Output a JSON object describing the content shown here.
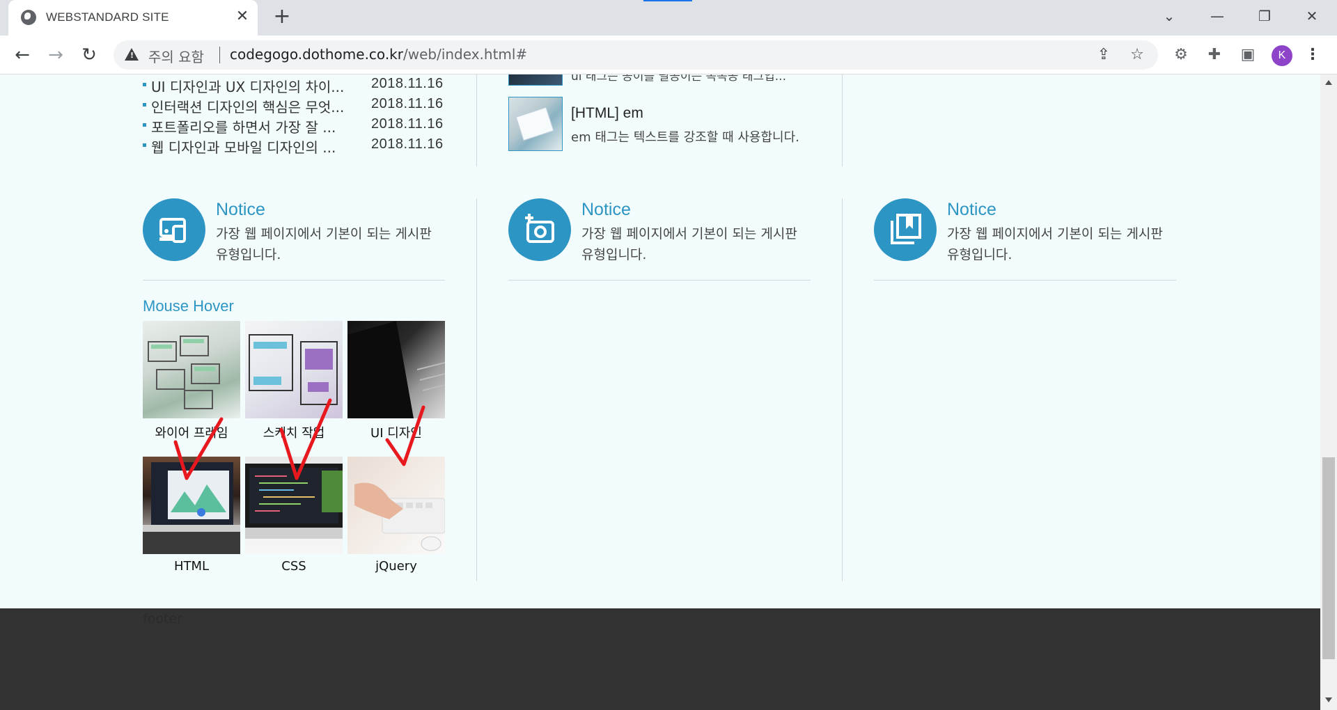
{
  "browser": {
    "tab_title": "WEBSTANDARD SITE",
    "tab_close": "✕",
    "new_tab": "+",
    "security_label": "주의 요함",
    "url_host": "codegogo.dothome.co.kr",
    "url_path": "/web/index.html#",
    "avatar_letter": "K"
  },
  "news": {
    "items": [
      {
        "title": "UI 디자인과 UX 디자인의 차이...",
        "date": "2018.11.16"
      },
      {
        "title": "인터랙션 디자인의 핵심은 무엇...",
        "date": "2018.11.16"
      },
      {
        "title": "포트폴리오를 하면서 가장 잘 ...",
        "date": "2018.11.16"
      },
      {
        "title": "웹 디자인과 모바일 디자인의 ...",
        "date": "2018.11.16"
      }
    ]
  },
  "posts": {
    "prev_desc": "ul 태그는 공이를 필공이는 녹녹공 태그입...",
    "title": "[HTML] em",
    "desc": "em 태그는 텍스트를 강조할 때 사용합니다."
  },
  "notices": [
    {
      "title": "Notice",
      "desc": "가장 웹 페이지에서 기본이 되는 게시판 유형입니다.",
      "icon": "devices-icon"
    },
    {
      "title": "Notice",
      "desc": "가장 웹 페이지에서 기본이 되는 게시판 유형입니다.",
      "icon": "add-camera-icon"
    },
    {
      "title": "Notice",
      "desc": "가장 웹 페이지에서 기본이 되는 게시판 유형입니다.",
      "icon": "bookmark-collection-icon"
    }
  ],
  "gallery": {
    "title": "Mouse Hover",
    "items": [
      {
        "caption": "와이어 프레임"
      },
      {
        "caption": "스케치 작업"
      },
      {
        "caption": "UI 디자인"
      },
      {
        "caption": "HTML"
      },
      {
        "caption": "CSS"
      },
      {
        "caption": "jQuery"
      }
    ]
  },
  "footer": {
    "text": "footer"
  },
  "colors": {
    "accent": "#2d95c4",
    "footer_bg": "#333333",
    "page_bg": "#f3fcfd",
    "annotation": "#e8191e"
  }
}
